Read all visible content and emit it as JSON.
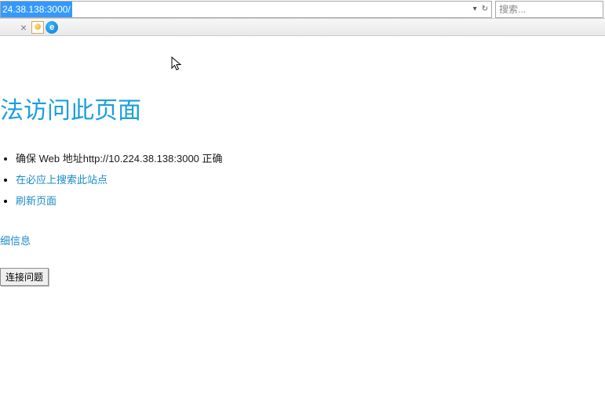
{
  "toolbar": {
    "url": "24.38.138:3000/",
    "dropdown_char": "▾",
    "refresh_char": "↻",
    "search_placeholder": "搜索..."
  },
  "tabbar": {
    "close_char": "×"
  },
  "error": {
    "heading": "法访问此页面",
    "msg_check_url": "确保 Web 地址http://10.224.38.138:3000 正确",
    "link_bing_search": "在必应上搜索此站点",
    "link_refresh": "刷新页面",
    "more_info": "细信息",
    "fix_button": "连接问题"
  }
}
